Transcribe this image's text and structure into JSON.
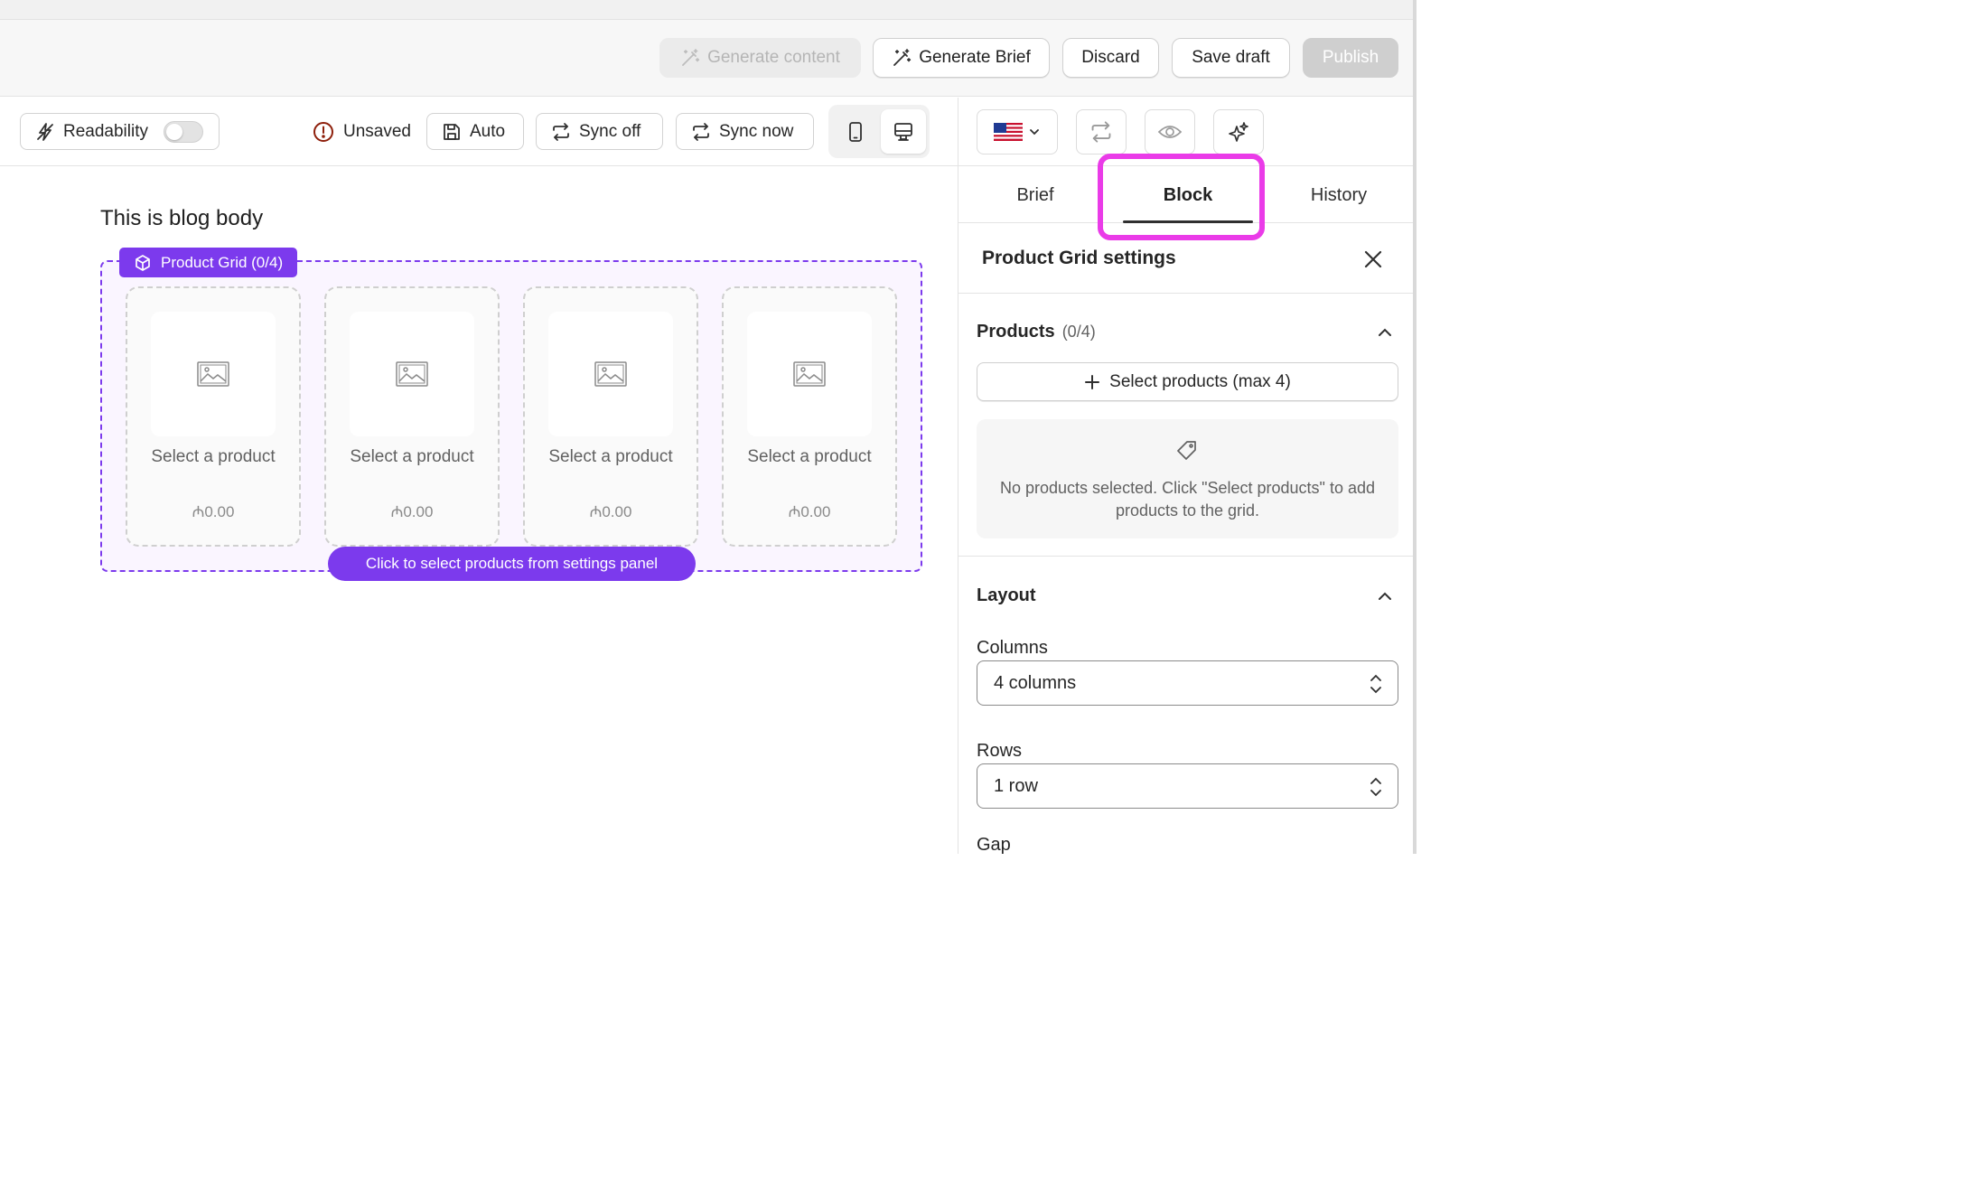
{
  "header": {
    "generate_content": "Generate content",
    "generate_brief": "Generate Brief",
    "discard": "Discard",
    "save_draft": "Save draft",
    "publish": "Publish"
  },
  "toolbar": {
    "readability": "Readability",
    "readability_on": false,
    "unsaved": "Unsaved",
    "auto": "Auto",
    "sync_off": "Sync off",
    "sync_now": "Sync now"
  },
  "canvas": {
    "body_text": "This is blog body",
    "grid_label": "Product Grid (0/4)",
    "cards": [
      {
        "name": "Select a product",
        "price": "₼0.00"
      },
      {
        "name": "Select a product",
        "price": "₼0.00"
      },
      {
        "name": "Select a product",
        "price": "₼0.00"
      },
      {
        "name": "Select a product",
        "price": "₼0.00"
      }
    ],
    "hint": "Click to select products from settings panel"
  },
  "panel": {
    "tabs": [
      "Brief",
      "Block",
      "History"
    ],
    "active_tab": "Block",
    "settings_title": "Product Grid settings",
    "products": {
      "title": "Products",
      "count": "(0/4)",
      "select_button": "Select products (max 4)",
      "empty_message": "No products selected. Click \"Select products\" to add products to the grid."
    },
    "layout": {
      "title": "Layout",
      "columns_label": "Columns",
      "columns_value": "4 columns",
      "rows_label": "Rows",
      "rows_value": "1 row",
      "gap_label": "Gap"
    }
  },
  "colors": {
    "accent": "#7c3aed",
    "highlight": "#ea3be8"
  }
}
